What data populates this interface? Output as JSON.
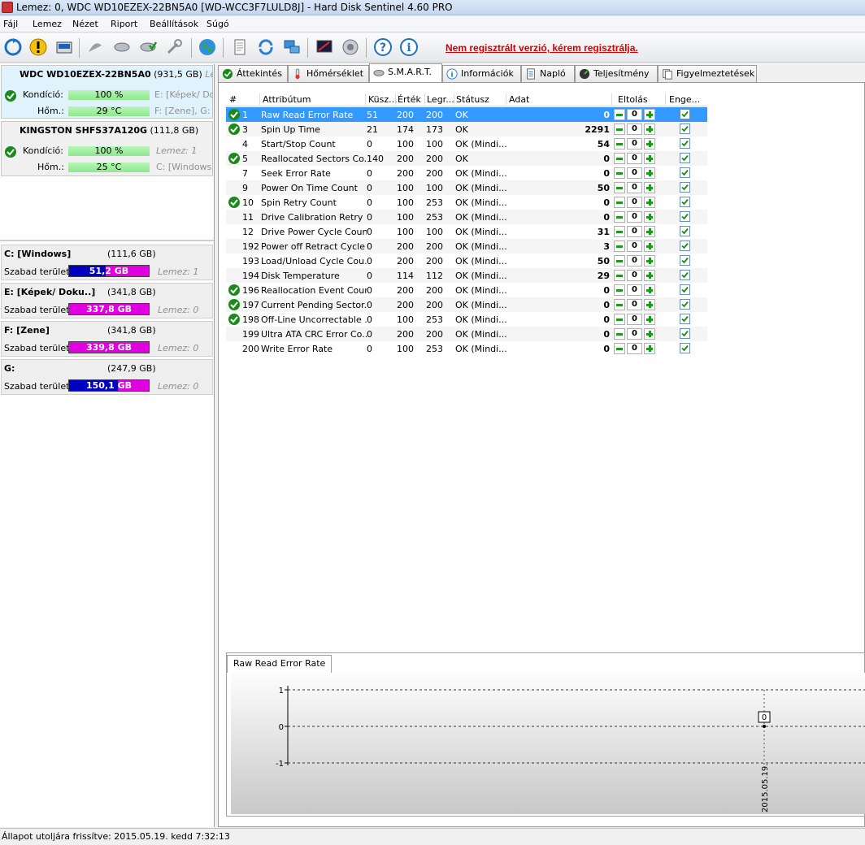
{
  "window": {
    "title": "Lemez: 0, WDC WD10EZEX-22BN5A0 [WD-WCC3F7LULD8J]  -  Hard Disk Sentinel 4.60 PRO"
  },
  "menu": [
    "Fájl",
    "Lemez",
    "Nézet",
    "Riport",
    "Beállítások",
    "Súgó"
  ],
  "register_link": "Nem regisztrált verzió, kérem regisztrálja.",
  "disks": [
    {
      "name": "WDC WD10EZEX-22BN5A0",
      "size": "(931,5 GB)",
      "extra": "Leme",
      "cond_label": "Kondíció:",
      "cond": "100 %",
      "temp_label": "Hőm.:",
      "temp": "29 °C",
      "side1": "E: [Képek/ Do",
      "side2": "F: [Zene], G:"
    },
    {
      "name": "KINGSTON SHFS37A120G",
      "size": "(111,8 GB)",
      "extra": "",
      "cond_label": "Kondíció:",
      "cond": "100 %",
      "temp_label": "Hőm.:",
      "temp": "25 °C",
      "side1": "Lemez: 1",
      "side2": "C: [Windows]"
    }
  ],
  "volumes": [
    {
      "name": "C: [Windows]",
      "size": "(111,6 GB)",
      "free_label": "Szabad terület",
      "free": "51,2 GB",
      "lemez": "Lemez: 1",
      "fill": 0.46
    },
    {
      "name": "E: [Képek/ Doku..]",
      "size": "(341,8 GB)",
      "free_label": "Szabad terület",
      "free": "337,8 GB",
      "lemez": "Lemez: 0",
      "fill": 0.0
    },
    {
      "name": "F: [Zene]",
      "size": "(341,8 GB)",
      "free_label": "Szabad terület",
      "free": "339,8 GB",
      "lemez": "Lemez: 0",
      "fill": 0.0
    },
    {
      "name": "G:",
      "size": "(247,9 GB)",
      "free_label": "Szabad terület",
      "free": "150,1 GB",
      "lemez": "Lemez: 0",
      "fill": 0.61
    }
  ],
  "tabs": [
    "Áttekintés",
    "Hőmérséklet",
    "S.M.A.R.T.",
    "Információk",
    "Napló",
    "Teljesítmény",
    "Figyelmeztetések"
  ],
  "table": {
    "headers": [
      "#",
      "Attribútum",
      "Küsz...",
      "Érték",
      "Legr...",
      "Státusz",
      "Adat",
      "Eltolás",
      "Enge..."
    ],
    "rows": [
      {
        "num": "1",
        "attr": "Raw Read Error Rate",
        "th": "51",
        "val": "200",
        "wst": "200",
        "st": "OK",
        "data": "0",
        "off": "0",
        "ok": true
      },
      {
        "num": "3",
        "attr": "Spin Up Time",
        "th": "21",
        "val": "174",
        "wst": "173",
        "st": "OK",
        "data": "2291",
        "off": "0",
        "ok": true
      },
      {
        "num": "4",
        "attr": "Start/Stop Count",
        "th": "0",
        "val": "100",
        "wst": "100",
        "st": "OK (Mindi...",
        "data": "54",
        "off": "0",
        "ok": false
      },
      {
        "num": "5",
        "attr": "Reallocated Sectors Co...",
        "th": "140",
        "val": "200",
        "wst": "200",
        "st": "OK",
        "data": "0",
        "off": "0",
        "ok": true
      },
      {
        "num": "7",
        "attr": "Seek Error Rate",
        "th": "0",
        "val": "200",
        "wst": "200",
        "st": "OK (Mindi...",
        "data": "0",
        "off": "0",
        "ok": false
      },
      {
        "num": "9",
        "attr": "Power On Time Count",
        "th": "0",
        "val": "100",
        "wst": "100",
        "st": "OK (Mindi...",
        "data": "50",
        "off": "0",
        "ok": false
      },
      {
        "num": "10",
        "attr": "Spin Retry Count",
        "th": "0",
        "val": "100",
        "wst": "253",
        "st": "OK (Mindi...",
        "data": "0",
        "off": "0",
        "ok": true
      },
      {
        "num": "11",
        "attr": "Drive Calibration Retry ...",
        "th": "0",
        "val": "100",
        "wst": "253",
        "st": "OK (Mindi...",
        "data": "0",
        "off": "0",
        "ok": false
      },
      {
        "num": "12",
        "attr": "Drive Power Cycle Count",
        "th": "0",
        "val": "100",
        "wst": "100",
        "st": "OK (Mindi...",
        "data": "31",
        "off": "0",
        "ok": false
      },
      {
        "num": "192",
        "attr": "Power off Retract Cycle ...",
        "th": "0",
        "val": "200",
        "wst": "200",
        "st": "OK (Mindi...",
        "data": "3",
        "off": "0",
        "ok": false
      },
      {
        "num": "193",
        "attr": "Load/Unload Cycle Cou...",
        "th": "0",
        "val": "200",
        "wst": "200",
        "st": "OK (Mindi...",
        "data": "50",
        "off": "0",
        "ok": false
      },
      {
        "num": "194",
        "attr": "Disk Temperature",
        "th": "0",
        "val": "114",
        "wst": "112",
        "st": "OK (Mindi...",
        "data": "29",
        "off": "0",
        "ok": false
      },
      {
        "num": "196",
        "attr": "Reallocation Event Count",
        "th": "0",
        "val": "200",
        "wst": "200",
        "st": "OK (Mindi...",
        "data": "0",
        "off": "0",
        "ok": true
      },
      {
        "num": "197",
        "attr": "Current Pending Sector...",
        "th": "0",
        "val": "200",
        "wst": "200",
        "st": "OK (Mindi...",
        "data": "0",
        "off": "0",
        "ok": true
      },
      {
        "num": "198",
        "attr": "Off-Line Uncorrectable ...",
        "th": "0",
        "val": "100",
        "wst": "253",
        "st": "OK (Mindi...",
        "data": "0",
        "off": "0",
        "ok": true
      },
      {
        "num": "199",
        "attr": "Ultra ATA CRC Error Co...",
        "th": "0",
        "val": "200",
        "wst": "200",
        "st": "OK (Mindi...",
        "data": "0",
        "off": "0",
        "ok": false
      },
      {
        "num": "200",
        "attr": "Write Error Rate",
        "th": "0",
        "val": "100",
        "wst": "253",
        "st": "OK (Mindi...",
        "data": "0",
        "off": "0",
        "ok": false
      }
    ]
  },
  "chart_tab": "Raw Read Error Rate",
  "chart_data": {
    "type": "line",
    "x": [
      "2015.05.19."
    ],
    "series": [
      {
        "values": [
          0
        ]
      }
    ],
    "ylim": [
      -1,
      1
    ],
    "yticks": [
      "1",
      "0",
      "-1"
    ],
    "point_label": "0"
  },
  "status": "Állapot utoljára frissítve: 2015.05.19. kedd 7:32:13"
}
